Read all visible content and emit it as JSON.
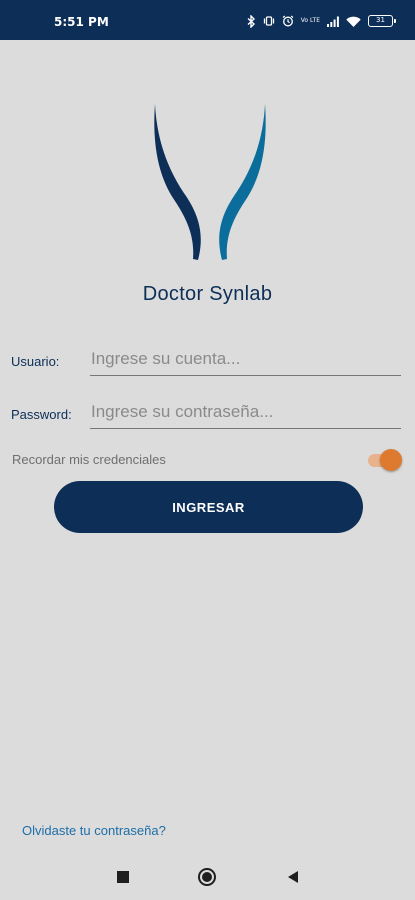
{
  "status_bar": {
    "time": "5:51 PM",
    "icons": [
      "bluetooth-icon",
      "vibrate-icon",
      "alarm-icon",
      "lte-icon",
      "signal-icon",
      "wifi-icon",
      "battery-icon"
    ],
    "network_label": "Vo LTE",
    "battery_level": "31"
  },
  "app": {
    "title": "Doctor Synlab"
  },
  "form": {
    "user_label": "Usuario:",
    "user_placeholder": "Ingrese su cuenta...",
    "password_label": "Password:",
    "password_placeholder": "Ingrese su contraseña...",
    "remember_label": "Recordar mis credenciales",
    "remember_enabled": true,
    "submit_label": "INGRESAR"
  },
  "footer": {
    "forgot_password": "Olvidaste tu contraseña?"
  },
  "nav": {
    "items": [
      "recents-icon",
      "home-icon",
      "back-icon"
    ]
  },
  "colors": {
    "primary": "#0c2e57",
    "accent": "#de7a30",
    "logo_light": "#0b6d9c",
    "link": "#1e6ea8",
    "background": "#dcdcdc"
  }
}
